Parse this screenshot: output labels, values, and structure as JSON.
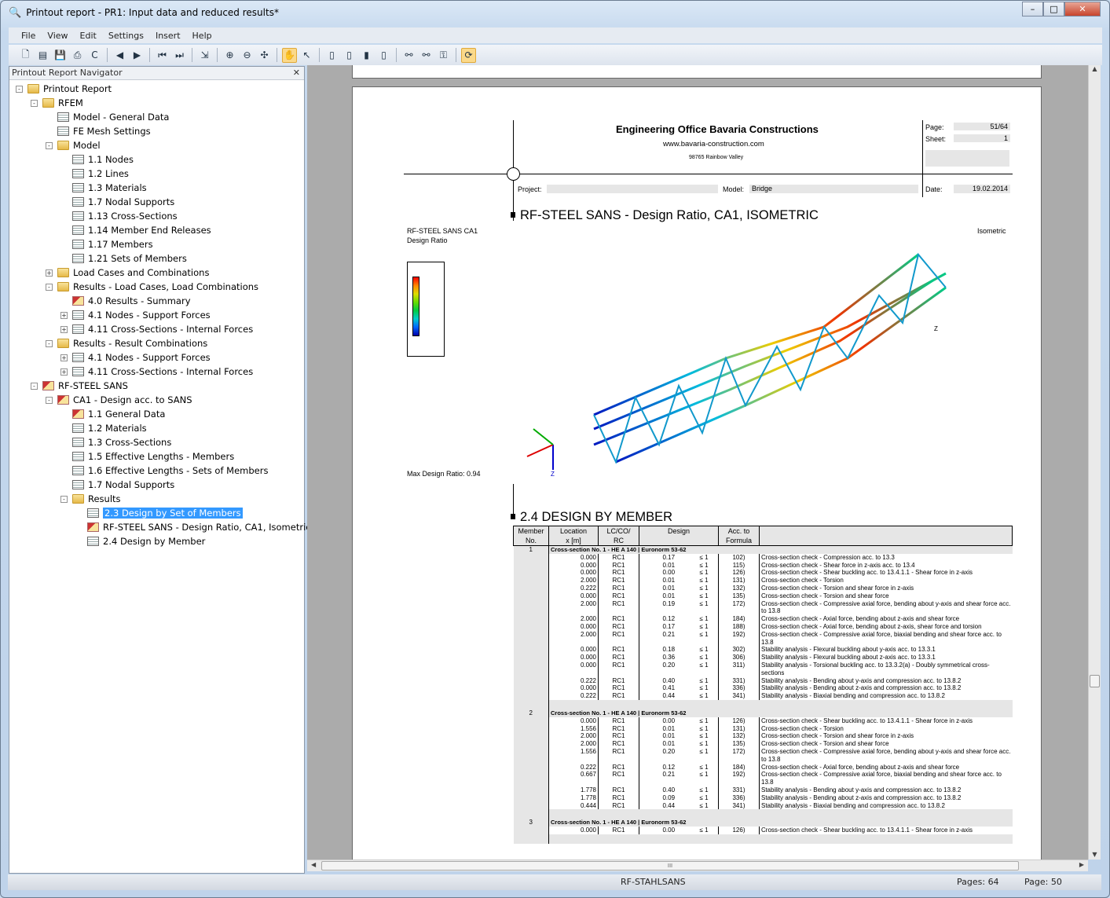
{
  "window": {
    "title": "Printout report - PR1: Input data and reduced results*",
    "controls": [
      "minimize",
      "maximize",
      "close"
    ]
  },
  "menu": [
    "File",
    "View",
    "Edit",
    "Settings",
    "Insert",
    "Help"
  ],
  "toolbar_icons": [
    "new-icon",
    "open-icon",
    "save-icon",
    "print-icon",
    "refresh-icon",
    "|",
    "prev-icon",
    "next-icon",
    "|",
    "first-icon",
    "last-icon",
    "|",
    "export-icon",
    "|",
    "zoom-in-icon",
    "zoom-out-icon",
    "settings-icon",
    "|",
    "hand-icon",
    "select-icon",
    "|",
    "page1-icon",
    "page2-icon",
    "page3-icon",
    "page4-icon",
    "|",
    "link1-icon",
    "link2-icon",
    "link3-icon",
    "|",
    "sync-icon"
  ],
  "navigator": {
    "title": "Printout Report Navigator",
    "items": [
      {
        "label": "Printout Report",
        "level": 0,
        "icon": "folder",
        "exp": "-"
      },
      {
        "label": "RFEM",
        "level": 1,
        "icon": "folder",
        "exp": "-"
      },
      {
        "label": "Model - General Data",
        "level": 2,
        "icon": "doc"
      },
      {
        "label": "FE Mesh Settings",
        "level": 2,
        "icon": "doc"
      },
      {
        "label": "Model",
        "level": 2,
        "icon": "folder",
        "exp": "-"
      },
      {
        "label": "1.1 Nodes",
        "level": 3,
        "icon": "doc"
      },
      {
        "label": "1.2 Lines",
        "level": 3,
        "icon": "doc"
      },
      {
        "label": "1.3 Materials",
        "level": 3,
        "icon": "doc"
      },
      {
        "label": "1.7 Nodal Supports",
        "level": 3,
        "icon": "doc"
      },
      {
        "label": "1.13 Cross-Sections",
        "level": 3,
        "icon": "doc"
      },
      {
        "label": "1.14 Member End Releases",
        "level": 3,
        "icon": "doc"
      },
      {
        "label": "1.17 Members",
        "level": 3,
        "icon": "doc"
      },
      {
        "label": "1.21 Sets of Members",
        "level": 3,
        "icon": "doc"
      },
      {
        "label": "Load Cases and Combinations",
        "level": 2,
        "icon": "folder",
        "exp": "+"
      },
      {
        "label": "Results - Load Cases, Load Combinations",
        "level": 2,
        "icon": "folder",
        "exp": "-"
      },
      {
        "label": "4.0 Results - Summary",
        "level": 3,
        "icon": "rf"
      },
      {
        "label": "4.1 Nodes - Support Forces",
        "level": 3,
        "icon": "doc",
        "exp": "+"
      },
      {
        "label": "4.11 Cross-Sections - Internal Forces",
        "level": 3,
        "icon": "doc",
        "exp": "+"
      },
      {
        "label": "Results - Result Combinations",
        "level": 2,
        "icon": "folder",
        "exp": "-"
      },
      {
        "label": "4.1 Nodes - Support Forces",
        "level": 3,
        "icon": "doc",
        "exp": "+"
      },
      {
        "label": "4.11 Cross-Sections - Internal Forces",
        "level": 3,
        "icon": "doc",
        "exp": "+"
      },
      {
        "label": "RF-STEEL SANS",
        "level": 1,
        "icon": "rf",
        "exp": "-"
      },
      {
        "label": "CA1 - Design acc. to SANS",
        "level": 2,
        "icon": "rf",
        "exp": "-"
      },
      {
        "label": "1.1 General Data",
        "level": 3,
        "icon": "rf"
      },
      {
        "label": "1.2 Materials",
        "level": 3,
        "icon": "doc"
      },
      {
        "label": "1.3 Cross-Sections",
        "level": 3,
        "icon": "doc"
      },
      {
        "label": "1.5 Effective Lengths - Members",
        "level": 3,
        "icon": "doc"
      },
      {
        "label": "1.6 Effective Lengths - Sets of Members",
        "level": 3,
        "icon": "doc"
      },
      {
        "label": "1.7 Nodal Supports",
        "level": 3,
        "icon": "doc"
      },
      {
        "label": "Results",
        "level": 3,
        "icon": "folder",
        "exp": "-"
      },
      {
        "label": "2.3 Design by Set of Members",
        "level": 4,
        "icon": "doc",
        "selected": true
      },
      {
        "label": "RF-STEEL SANS - Design Ratio, CA1, Isometric",
        "level": 4,
        "icon": "rf"
      },
      {
        "label": "2.4 Design by Member",
        "level": 4,
        "icon": "doc"
      }
    ]
  },
  "header": {
    "company": "Engineering Office Bavaria Constructions",
    "website": "www.bavaria-construction.com",
    "address": "98765 Rainbow Valley",
    "page_label": "Page:",
    "page_value": "51/64",
    "sheet_label": "Sheet:",
    "sheet_value": "1",
    "project_label": "Project:",
    "project_value": "",
    "model_label": "Model:",
    "model_value": "Bridge",
    "date_label": "Date:",
    "date_value": "19.02.2014"
  },
  "section1": {
    "title": "RF-STEEL SANS -  Design Ratio, CA1, ISOMETRIC",
    "caption1": "RF-STEEL SANS CA1",
    "caption2": "Design Ratio",
    "view": "Isometric",
    "max_ratio": "Max Design Ratio: 0.94",
    "axis_z": "Z",
    "axis_y": "Y"
  },
  "section2": {
    "title": "2.4 DESIGN BY MEMBER",
    "headers": {
      "member": [
        "Member",
        "No."
      ],
      "location": [
        "Location",
        "x [m]"
      ],
      "lc": [
        "LC/CO/",
        "RC"
      ],
      "design": "Design",
      "formula": [
        "Acc. to",
        "Formula"
      ]
    },
    "members": [
      {
        "no": "1",
        "section": "Cross-section No. 1 - HE A 140 | Euronorm 53-62",
        "rows": [
          [
            "0.000",
            "RC1",
            "0.17",
            "≤ 1",
            "102)",
            "Cross-section check - Compression acc. to 13.3"
          ],
          [
            "0.000",
            "RC1",
            "0.01",
            "≤ 1",
            "115)",
            "Cross-section check - Shear force in z-axis acc. to 13.4"
          ],
          [
            "0.000",
            "RC1",
            "0.00",
            "≤ 1",
            "126)",
            "Cross-section check - Shear buckling acc. to 13.4.1.1 - Shear force in z-axis"
          ],
          [
            "2.000",
            "RC1",
            "0.01",
            "≤ 1",
            "131)",
            "Cross-section check - Torsion"
          ],
          [
            "0.222",
            "RC1",
            "0.01",
            "≤ 1",
            "132)",
            "Cross-section check - Torsion and shear force in z-axis"
          ],
          [
            "0.000",
            "RC1",
            "0.01",
            "≤ 1",
            "135)",
            "Cross-section check - Torsion and shear force"
          ],
          [
            "2.000",
            "RC1",
            "0.19",
            "≤ 1",
            "172)",
            "Cross-section check - Compressive axial force, bending about y-axis and shear force acc. to 13.8"
          ],
          [
            "2.000",
            "RC1",
            "0.12",
            "≤ 1",
            "184)",
            "Cross-section check - Axial force, bending about z-axis and shear force"
          ],
          [
            "0.000",
            "RC1",
            "0.17",
            "≤ 1",
            "188)",
            "Cross-section check - Axial force, bending about z-axis, shear force and torsion"
          ],
          [
            "2.000",
            "RC1",
            "0.21",
            "≤ 1",
            "192)",
            "Cross-section check - Compressive axial force, biaxial bending and shear force acc. to 13.8"
          ],
          [
            "0.000",
            "RC1",
            "0.18",
            "≤ 1",
            "302)",
            "Stability analysis - Flexural buckling about y-axis acc. to 13.3.1"
          ],
          [
            "0.000",
            "RC1",
            "0.36",
            "≤ 1",
            "306)",
            "Stability analysis - Flexural buckling about z-axis acc. to 13.3.1"
          ],
          [
            "0.000",
            "RC1",
            "0.20",
            "≤ 1",
            "311)",
            "Stability analysis - Torsional buckling acc. to 13.3.2(a) - Doubly symmetrical cross-sections"
          ],
          [
            "0.222",
            "RC1",
            "0.40",
            "≤ 1",
            "331)",
            "Stability analysis - Bending about y-axis and compression acc. to 13.8.2"
          ],
          [
            "0.000",
            "RC1",
            "0.41",
            "≤ 1",
            "336)",
            "Stability analysis - Bending about z-axis and compression acc. to 13.8.2"
          ],
          [
            "0.222",
            "RC1",
            "0.44",
            "≤ 1",
            "341)",
            "Stability analysis - Biaxial bending and compression acc. to 13.8.2"
          ]
        ]
      },
      {
        "no": "2",
        "section": "Cross-section No. 1 - HE A 140 | Euronorm 53-62",
        "rows": [
          [
            "0.000",
            "RC1",
            "0.00",
            "≤ 1",
            "126)",
            "Cross-section check - Shear buckling acc. to 13.4.1.1 - Shear force in z-axis"
          ],
          [
            "1.556",
            "RC1",
            "0.01",
            "≤ 1",
            "131)",
            "Cross-section check - Torsion"
          ],
          [
            "2.000",
            "RC1",
            "0.01",
            "≤ 1",
            "132)",
            "Cross-section check - Torsion and shear force in z-axis"
          ],
          [
            "2.000",
            "RC1",
            "0.01",
            "≤ 1",
            "135)",
            "Cross-section check - Torsion and shear force"
          ],
          [
            "1.556",
            "RC1",
            "0.20",
            "≤ 1",
            "172)",
            "Cross-section check - Compressive axial force, bending about y-axis and shear force acc. to 13.8"
          ],
          [
            "0.222",
            "RC1",
            "0.12",
            "≤ 1",
            "184)",
            "Cross-section check - Axial force, bending about z-axis and shear force"
          ],
          [
            "0.667",
            "RC1",
            "0.21",
            "≤ 1",
            "192)",
            "Cross-section check - Compressive axial force, biaxial bending and shear force acc. to 13.8"
          ],
          [
            "1.778",
            "RC1",
            "0.40",
            "≤ 1",
            "331)",
            "Stability analysis - Bending about y-axis and compression acc. to 13.8.2"
          ],
          [
            "1.778",
            "RC1",
            "0.09",
            "≤ 1",
            "336)",
            "Stability analysis - Bending about z-axis and compression acc. to 13.8.2"
          ],
          [
            "0.444",
            "RC1",
            "0.44",
            "≤ 1",
            "341)",
            "Stability analysis - Biaxial bending and compression acc. to 13.8.2"
          ]
        ]
      },
      {
        "no": "3",
        "section": "Cross-section No. 1 - HE A 140 | Euronorm 53-62",
        "rows": [
          [
            "0.000",
            "RC1",
            "0.00",
            "≤ 1",
            "126)",
            "Cross-section check - Shear buckling acc. to 13.4.1.1 - Shear force in z-axis"
          ]
        ]
      }
    ]
  },
  "status": {
    "module": "RF-STAHLSANS",
    "pages": "Pages: 64",
    "page": "Page: 50"
  },
  "colors": {
    "selection": "#3399ff",
    "viewer_bg": "#ababab",
    "active_tool": "#fbd98a"
  }
}
